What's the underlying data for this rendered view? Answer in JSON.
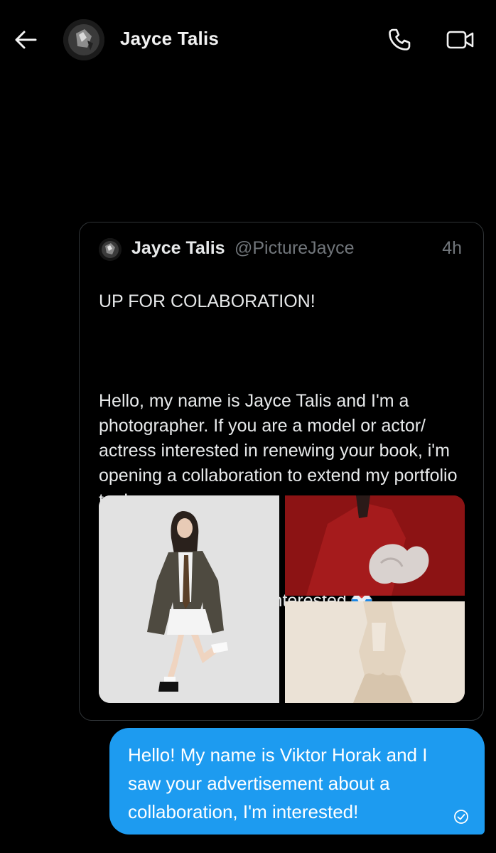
{
  "header": {
    "contact_name": "Jayce Talis",
    "icons": [
      "back-arrow-icon",
      "phone-icon",
      "video-camera-icon"
    ]
  },
  "tweet": {
    "author_name": "Jayce Talis",
    "author_handle": "@PictureJayce",
    "time": "4h",
    "headline": "UP FOR COLABORATION!",
    "paragraph": "Hello, my name is Jayce Talis and I'm a photographer. If you are a model or actor/ actress interested in renewing your book, i'm opening a collaboration to extend my portfolio too!",
    "cta": "Please DM if you are interested",
    "cta_emoji": "inbox-tray-icon",
    "media_count": 3
  },
  "message": {
    "text": "Hello! My name is Viktor Horak and I saw your advertisement about a collaboration, I'm interested!",
    "status_icon": "read-check-icon"
  },
  "colors": {
    "background": "#000000",
    "bubble": "#1d9bf0",
    "secondary_text": "#71767b",
    "border": "#2f3336"
  }
}
